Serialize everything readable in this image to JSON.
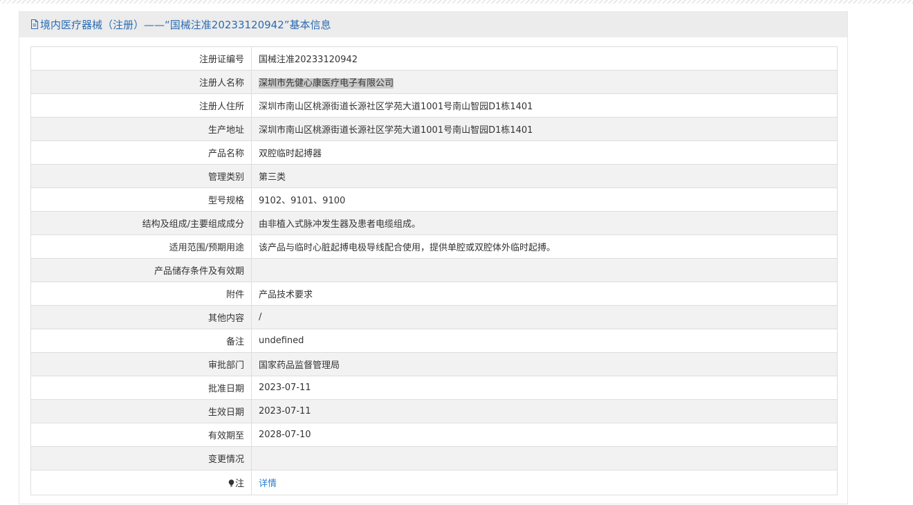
{
  "header": {
    "icon": "document-icon",
    "title": "境内医疗器械（注册）——“国械注准20233120942”基本信息"
  },
  "rows": [
    {
      "label": "注册证编号",
      "value": "国械注准20233120942"
    },
    {
      "label": "注册人名称",
      "value": "深圳市先健心康医疗电子有限公司",
      "highlighted": true
    },
    {
      "label": "注册人住所",
      "value": "深圳市南山区桃源街道长源社区学苑大道1001号南山智园D1栋1401"
    },
    {
      "label": "生产地址",
      "value": "深圳市南山区桃源街道长源社区学苑大道1001号南山智园D1栋1401"
    },
    {
      "label": "产品名称",
      "value": "双腔临时起搏器"
    },
    {
      "label": "管理类别",
      "value": "第三类"
    },
    {
      "label": "型号规格",
      "value": "9102、9101、9100"
    },
    {
      "label": "结构及组成/主要组成成分",
      "value": "由非植入式脉冲发生器及患者电缆组成。"
    },
    {
      "label": "适用范围/预期用途",
      "value": "该产品与临时心脏起搏电极导线配合使用，提供单腔或双腔体外临时起搏。"
    },
    {
      "label": "产品储存条件及有效期",
      "value": ""
    },
    {
      "label": "附件",
      "value": "产品技术要求"
    },
    {
      "label": "其他内容",
      "value": "/"
    },
    {
      "label": "备注",
      "value": "undefined"
    },
    {
      "label": "审批部门",
      "value": "国家药品监督管理局"
    },
    {
      "label": "批准日期",
      "value": "2023-07-11"
    },
    {
      "label": "生效日期",
      "value": "2023-07-11"
    },
    {
      "label": "有效期至",
      "value": "2028-07-10"
    },
    {
      "label": "变更情况",
      "value": ""
    }
  ],
  "note": {
    "icon": "lightbulb-icon",
    "label": "注",
    "link": "详情"
  },
  "colors": {
    "header_text": "#2a6bb3",
    "header_bg": "#ececec",
    "link": "#2a7fd4",
    "highlight": "#c9c9c9"
  }
}
